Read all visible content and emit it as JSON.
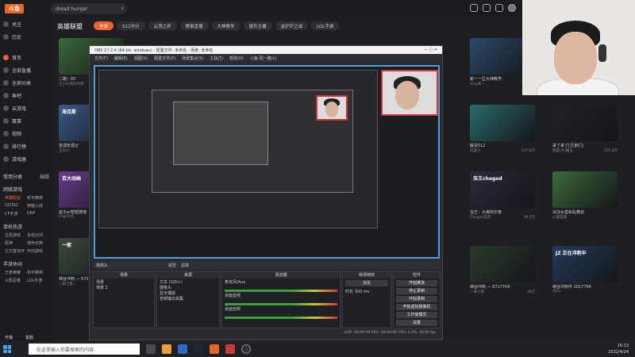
{
  "app": {
    "logo_text": "斗鱼",
    "search_text": "dread hunger"
  },
  "sidebar": {
    "top_items": [
      {
        "label": "关注"
      },
      {
        "label": "历史"
      }
    ],
    "items": [
      {
        "label": "首页"
      },
      {
        "label": "全部直播"
      },
      {
        "label": "全部分类"
      },
      {
        "label": "鱼吧"
      },
      {
        "label": "云游戏"
      },
      {
        "label": "赛事"
      },
      {
        "label": "视频"
      },
      {
        "label": "排行榜"
      },
      {
        "label": "游戏器"
      }
    ],
    "section_common": "常用分类",
    "section_common_action": "编辑",
    "section_online": "网络游戏",
    "online_games": [
      "英雄联盟",
      "和平精英",
      "DOTA2",
      "穿越火线",
      "CF手游",
      "DNF"
    ],
    "section_single": "单机热游",
    "single_games": [
      "主机游戏",
      "永劫无间",
      "原神",
      "使命召唤",
      "艾尔登法环",
      "怀旧游戏"
    ],
    "section_mobile": "手游休闲",
    "mobile_games": [
      "王者荣耀",
      "和平精英",
      "火影忍者",
      "LOL手游"
    ],
    "bottom_open": "开播",
    "bottom_client": "客服"
  },
  "main": {
    "category_title": "英雄联盟",
    "chips": [
      {
        "label": "全部",
        "active": true
      },
      {
        "label": "S12冲分"
      },
      {
        "label": "云顶之弈"
      },
      {
        "label": "赛事直播"
      },
      {
        "label": "大神教学"
      },
      {
        "label": "娱乐主播"
      },
      {
        "label": "金铲铲之战"
      },
      {
        "label": "LOL手游"
      }
    ],
    "cards": [
      {
        "title": "二路！四！",
        "sub": "王小叮和鸡鸡哥",
        "thumb_label": "",
        "color": "#3a6a3a"
      },
      {
        "title": "荒漠奇遇记",
        "sub": "王剑小",
        "thumb_label": "海克斯",
        "color": "#3a5a8a"
      },
      {
        "title": "蓝子er帮帮搜搜",
        "sub": "imgOUD",
        "thumb_label": "百大动画",
        "color": "#6a3a8a"
      },
      {
        "title": "解说S12",
        "sub": "剑圣小",
        "thumb_label": "",
        "color": "#2a6a6a"
      },
      {
        "title": "新一一区大神教学",
        "sub": "Xiny新一",
        "thumb_label": "",
        "color": "#2a4a6a"
      },
      {
        "title": "来了来了[兄弟们]",
        "sub": "我是[大]魔王",
        "thumb_label": "",
        "color": "#222226"
      },
      {
        "title": "冰冻女皇和乱舞剑",
        "sub": "心愿圆满",
        "thumb_label": "",
        "color": "#3a6a3a"
      },
      {
        "title": "虫王：大美阿尔泰",
        "sub": "Chogod虫哥",
        "thumb_label": "虫王chogod",
        "color": "#2a2a3a"
      },
      {
        "title": "峡谷冲刺 — 6717704",
        "sub": "一家之家",
        "thumb_label": "一家",
        "color": "#3a4a3a"
      },
      {
        "title": "峡谷冲刺 — 6717704",
        "sub": "一家之家",
        "thumb_label": "",
        "color": "#2a3a2a"
      },
      {
        "title": "峡谷冲刺中 2017704",
        "sub": "ZJGo",
        "thumb_label": "JZ 正在冲刺中",
        "color": "#223a5a"
      }
    ],
    "card_viewers": [
      "57万",
      "20万",
      "8.3万",
      "127.8万",
      "127.8万",
      "125.8万",
      "4.9万",
      "50.1万",
      "38万"
    ]
  },
  "obs": {
    "title": "OBS 27.2.4 (64-bit, windows) - 配置文件: 未命名 - 场景: 未命名",
    "menu": [
      "文件(F)",
      "编辑(E)",
      "视图(V)",
      "配置文件(P)",
      "场景集合(S)",
      "工具(T)",
      "帮助(H)",
      "斗鱼-同一路(L)"
    ],
    "source_bar": [
      "摄像头",
      "属性",
      "滤镜"
    ],
    "docks": {
      "scenes_title": "场景",
      "scenes": [
        "场景",
        "场景 2"
      ],
      "sources_title": "来源",
      "sources": [
        "文本 (GDI+)",
        "摄像头",
        "显示捕获",
        "音频输出采集"
      ],
      "mixer_title": "混音器",
      "mixer_tracks": [
        "麦克风/Aux",
        "桌面音频",
        "桌面音频"
      ],
      "trans_title": "转场特效",
      "trans_value": "淡化",
      "trans_duration_label": "时长",
      "trans_duration": "300 ms",
      "controls_title": "控件",
      "controls": [
        "开始推流",
        "停止录制",
        "开始录制",
        "开始虚拟摄像机",
        "工作室模式",
        "设置",
        "退出"
      ]
    },
    "status": "LIVE: 00:00:00   REC: 00:00:00   CPU: 4.3%, 30.00 fps"
  },
  "taskbar": {
    "search_placeholder": "在这里输入你要搜索的内容",
    "time": "16:13",
    "date": "2022/4/24"
  }
}
